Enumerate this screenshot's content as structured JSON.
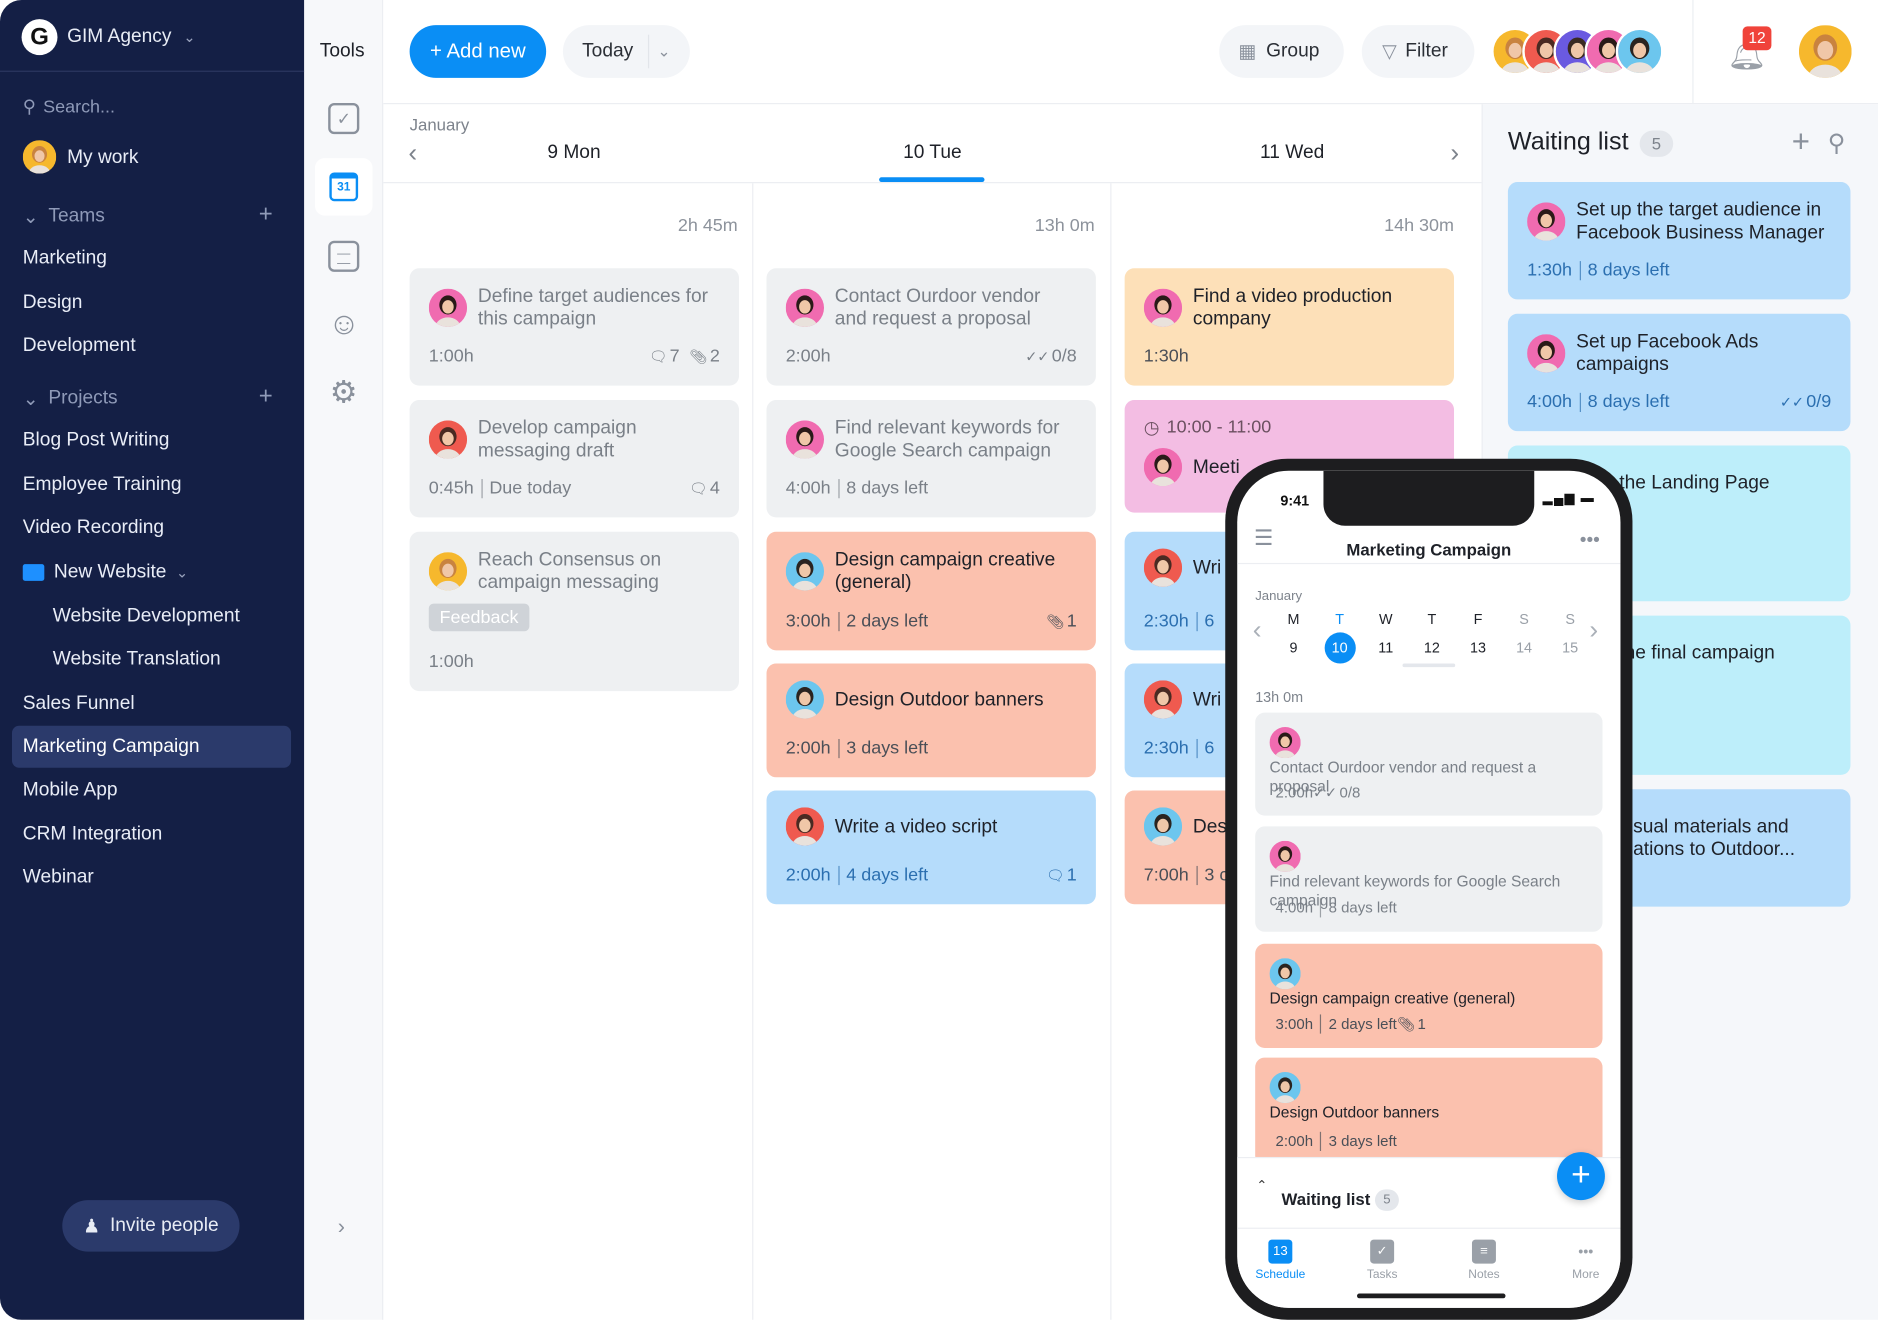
{
  "colors": {
    "accent": "#0a8ef5",
    "sidebar": "#141f45",
    "grey_card": "#eef0f2",
    "orange_card": "#fde0b8",
    "pink_card": "#f3bde3",
    "salmon_card": "#fbc1ae",
    "blue_card": "#b5dcfb",
    "cyan_card": "#bdeefa",
    "badge_red": "#f0433a"
  },
  "sidebar": {
    "workspace": "GIM Agency",
    "search_placeholder": "Search...",
    "my_work": "My work",
    "teams_label": "Teams",
    "teams": [
      "Marketing",
      "Design",
      "Development"
    ],
    "projects_label": "Projects",
    "projects": [
      "Blog Post Writing",
      "Employee Training",
      "Video Recording"
    ],
    "folder": "New Website",
    "folder_items": [
      "Website Development",
      "Website Translation"
    ],
    "projects_more": [
      "Sales Funnel",
      "Marketing Campaign",
      "Mobile App",
      "CRM Integration",
      "Webinar"
    ],
    "active": "Marketing Campaign",
    "invite": "Invite people"
  },
  "tools": {
    "title": "Tools",
    "calendar_day": "31"
  },
  "topbar": {
    "add_new": "+ Add new",
    "today": "Today",
    "group": "Group",
    "filter": "Filter",
    "notifications": "12"
  },
  "calendar": {
    "month": "January",
    "days": [
      {
        "label": "9 Mon",
        "total": "2h 45m"
      },
      {
        "label": "10 Tue",
        "total": "13h 0m"
      },
      {
        "label": "11 Wed",
        "total": "14h 30m"
      }
    ],
    "selected_day": "10 Tue",
    "columns": [
      [
        {
          "title": "Define target audiences for this campaign",
          "time": "1:00h",
          "badges": [
            {
              "icon": "comment-icon",
              "value": "7"
            },
            {
              "icon": "attachment-icon",
              "value": "2"
            }
          ],
          "color": "grey",
          "avatar": "pink"
        },
        {
          "title": "Develop campaign messaging draft",
          "time": "0:45h",
          "due": "Due today",
          "badges": [
            {
              "icon": "comment-icon",
              "value": "4"
            }
          ],
          "color": "grey",
          "avatar": "red"
        },
        {
          "title": "Reach Consensus on campaign messaging",
          "tag": "Feedback",
          "time": "1:00h",
          "color": "grey",
          "avatar": "yellow"
        }
      ],
      [
        {
          "title": "Contact Ourdoor vendor and request a proposal",
          "time": "2:00h",
          "badges": [
            {
              "icon": "checklist-icon",
              "value": "0/8"
            }
          ],
          "color": "grey",
          "avatar": "pink"
        },
        {
          "title": "Find relevant keywords for Google Search campaign",
          "time": "4:00h",
          "due": "8 days left",
          "color": "grey",
          "avatar": "pink"
        },
        {
          "title": "Design campaign creative (general)",
          "time": "3:00h",
          "due": "2 days left",
          "badges": [
            {
              "icon": "attachment-icon",
              "value": "1"
            }
          ],
          "color": "salmon",
          "avatar": "sky"
        },
        {
          "title": "Design Outdoor banners",
          "time": "2:00h",
          "due": "3 days left",
          "color": "salmon",
          "avatar": "sky"
        },
        {
          "title": "Write a video script",
          "time": "2:00h",
          "due": "4 days left",
          "badges": [
            {
              "icon": "comment-icon",
              "value": "1"
            }
          ],
          "color": "blue",
          "avatar": "red"
        }
      ],
      [
        {
          "title": "Find a video production company",
          "time": "1:30h",
          "color": "orange",
          "avatar": "pink"
        },
        {
          "clock": "10:00 - 11:00",
          "title": "Meeti",
          "color": "pink",
          "avatar": "pink"
        },
        {
          "title": "Wri Ads",
          "time": "2:30h",
          "due": "6",
          "color": "blue",
          "avatar": "red"
        },
        {
          "title": "Wri Fac",
          "time": "2:30h",
          "due": "6",
          "color": "blue",
          "avatar": "red"
        },
        {
          "title": "Des",
          "time": "7:00h",
          "due": "3 c",
          "color": "salmon",
          "avatar": "sky"
        }
      ]
    ]
  },
  "waiting": {
    "title": "Waiting list",
    "count": "5",
    "items": [
      {
        "title": "Set up the target audience in Facebook Business Manager",
        "time": "1:30h",
        "due": "8 days left",
        "color": "blue",
        "avatar": "pink"
      },
      {
        "title": "Set up Facebook Ads campaigns",
        "time": "4:00h",
        "due": "8 days left",
        "badges": [
          {
            "icon": "checklist-icon",
            "value": "0/9"
          }
        ],
        "color": "blue",
        "avatar": "pink"
      },
      {
        "title": "the Landing Page",
        "color": "cyan"
      },
      {
        "title": "the final campaign",
        "color": "cyan"
      },
      {
        "title": "visual materials and ications to Outdoor...",
        "color": "blue"
      }
    ]
  },
  "phone": {
    "time": "9:41",
    "title": "Marketing Campaign",
    "month": "January",
    "weekdays": [
      "M",
      "T",
      "W",
      "T",
      "F",
      "S",
      "S"
    ],
    "dates": [
      "9",
      "10",
      "11",
      "12",
      "13",
      "14",
      "15"
    ],
    "selected": "10",
    "total": "13h 0m",
    "cards": [
      {
        "title": "Contact Ourdoor vendor and request a proposal",
        "time": "2:00h",
        "badges": [
          {
            "icon": "checklist-icon",
            "value": "0/8"
          }
        ],
        "color": "grey",
        "avatar": "pink"
      },
      {
        "title": "Find relevant keywords for Google Search campaign",
        "time": "4:00h",
        "due": "8 days left",
        "color": "grey",
        "avatar": "pink"
      },
      {
        "title": "Design campaign creative (general)",
        "time": "3:00h",
        "due": "2 days left",
        "badges": [
          {
            "icon": "attachment-icon",
            "value": "1"
          }
        ],
        "color": "salmon",
        "avatar": "sky"
      },
      {
        "title": "Design Outdoor banners",
        "time": "2:00h",
        "due": "3 days left",
        "color": "salmon",
        "avatar": "sky"
      }
    ],
    "waiting_label": "Waiting list",
    "waiting_count": "5",
    "nav": [
      {
        "label": "Schedule",
        "icon": "calendar-icon",
        "badge": "13",
        "active": true
      },
      {
        "label": "Tasks",
        "icon": "tasks-icon"
      },
      {
        "label": "Notes",
        "icon": "notes-icon"
      },
      {
        "label": "More",
        "icon": "more-icon"
      }
    ]
  }
}
